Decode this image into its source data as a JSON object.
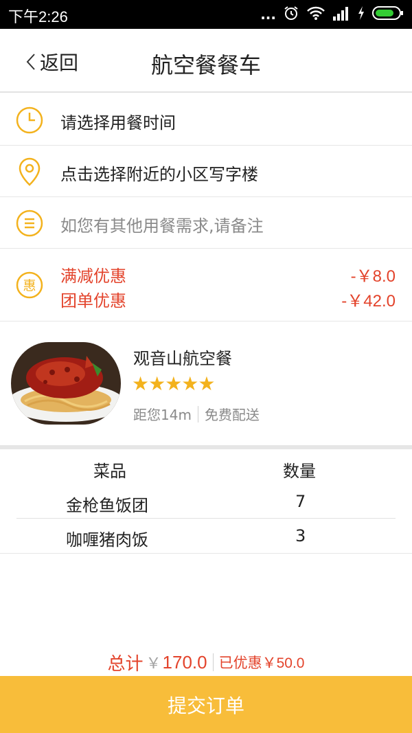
{
  "status_bar": {
    "time": "下午2:26",
    "dots": "...",
    "icons": [
      "alarm-icon",
      "wifi-icon",
      "signal-icon",
      "charging-icon",
      "battery-icon"
    ]
  },
  "navbar": {
    "back_label": "返回",
    "title": "航空餐餐车"
  },
  "form": {
    "time_label": "请选择用餐时间",
    "location_label": "点击选择附近的小区写字楼",
    "note_placeholder": "如您有其他用餐需求,请备注"
  },
  "discount": {
    "icon_char": "惠",
    "items": [
      {
        "label": "满减优惠",
        "value": "-￥8.0"
      },
      {
        "label": "团单优惠",
        "value": "-￥42.0"
      }
    ]
  },
  "shop": {
    "name": "观音山航空餐",
    "rating": 5,
    "stars": "★★★★★",
    "distance": "距您14m",
    "delivery": "免费配送"
  },
  "order_table": {
    "headers": {
      "dish": "菜品",
      "quantity": "数量"
    },
    "rows": [
      {
        "dish": "金枪鱼饭团",
        "quantity": "7"
      },
      {
        "dish": "咖喱猪肉饭",
        "quantity": "3"
      }
    ]
  },
  "summary": {
    "total_label": "总计",
    "currency": "￥",
    "total_amount": "170.0",
    "saved_text": "已优惠￥50.0"
  },
  "submit_label": "提交订单",
  "colors": {
    "accent": "#f8bd3a",
    "icon": "#f3b21d",
    "discount": "#e3432b"
  }
}
